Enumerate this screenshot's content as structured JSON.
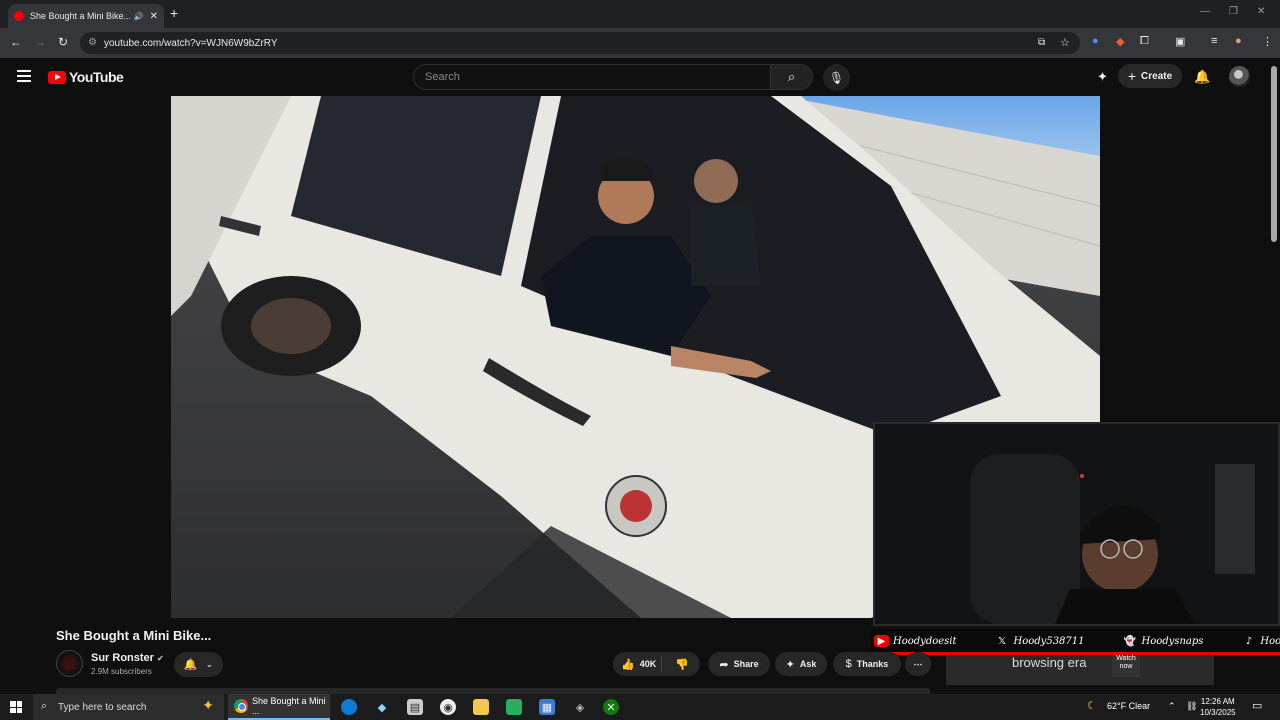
{
  "browser": {
    "tab_title": "She Bought a Mini Bike... - YouTube",
    "url": "youtube.com/watch?v=WJN6W9bZrRY"
  },
  "youtube": {
    "search_placeholder": "Search",
    "create_label": "Create",
    "logo_text": "YouTube"
  },
  "video": {
    "title": "She Bought a Mini Bike...",
    "channel_name": "Sur Ronster",
    "subscribers": "2.9M subscribers",
    "actions": {
      "likes": "40K",
      "share": "Share",
      "ask": "Ask",
      "thanks": "Thanks"
    }
  },
  "stream_overlay": {
    "socials": [
      {
        "icon": "youtube-icon",
        "handle": "Hoodydoesit"
      },
      {
        "icon": "x-icon",
        "handle": "Hoody538711"
      },
      {
        "icon": "snapchat-icon",
        "handle": "Hoodysnaps"
      },
      {
        "icon": "tiktok-icon",
        "handle": "Hoodyislive"
      }
    ],
    "ad_text": "browsing era",
    "ad_watch": "Watch now"
  },
  "taskbar": {
    "search_placeholder": "Type here to search",
    "active_app": "She Bought a Mini ...",
    "weather": "62°F  Clear",
    "time": "12:26 AM",
    "date": "10/3/2025"
  },
  "colors": {
    "youtube_red": "#ff0000",
    "background": "#0f0f0f",
    "pill": "#272727"
  }
}
